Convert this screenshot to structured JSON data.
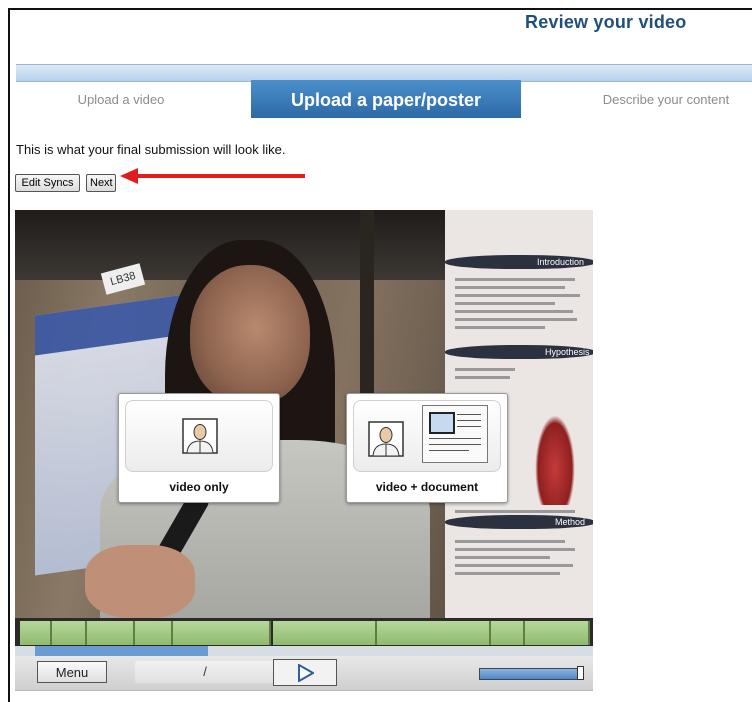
{
  "header": {
    "title": "Review your video"
  },
  "steps": [
    {
      "label": "Upload a video",
      "state": "done"
    },
    {
      "label": "Upload a paper/poster",
      "state": "active"
    },
    {
      "label": "Describe your content",
      "state": "pending"
    }
  ],
  "intro": "This is what your final submission will look like.",
  "buttons": {
    "edit_syncs": "Edit Syncs",
    "next": "Next"
  },
  "video": {
    "sign_text": "LB38",
    "overlay_choices": [
      {
        "label": "video only",
        "icon": "person-icon"
      },
      {
        "label": "video + document",
        "icon": "person-document-icon"
      }
    ],
    "poster_headings": [
      "Introduction",
      "Hypothesis",
      "Method"
    ]
  },
  "player": {
    "menu_label": "Menu",
    "time_text": "/",
    "play_icon": "play-icon",
    "progress_fraction": 0.31,
    "volume_fraction": 1.0
  },
  "colors": {
    "title": "#1f4f7d",
    "active_step": "#2d6aa6",
    "arrow": "#e21b1b",
    "timeline_segment": "#9cc47b"
  }
}
